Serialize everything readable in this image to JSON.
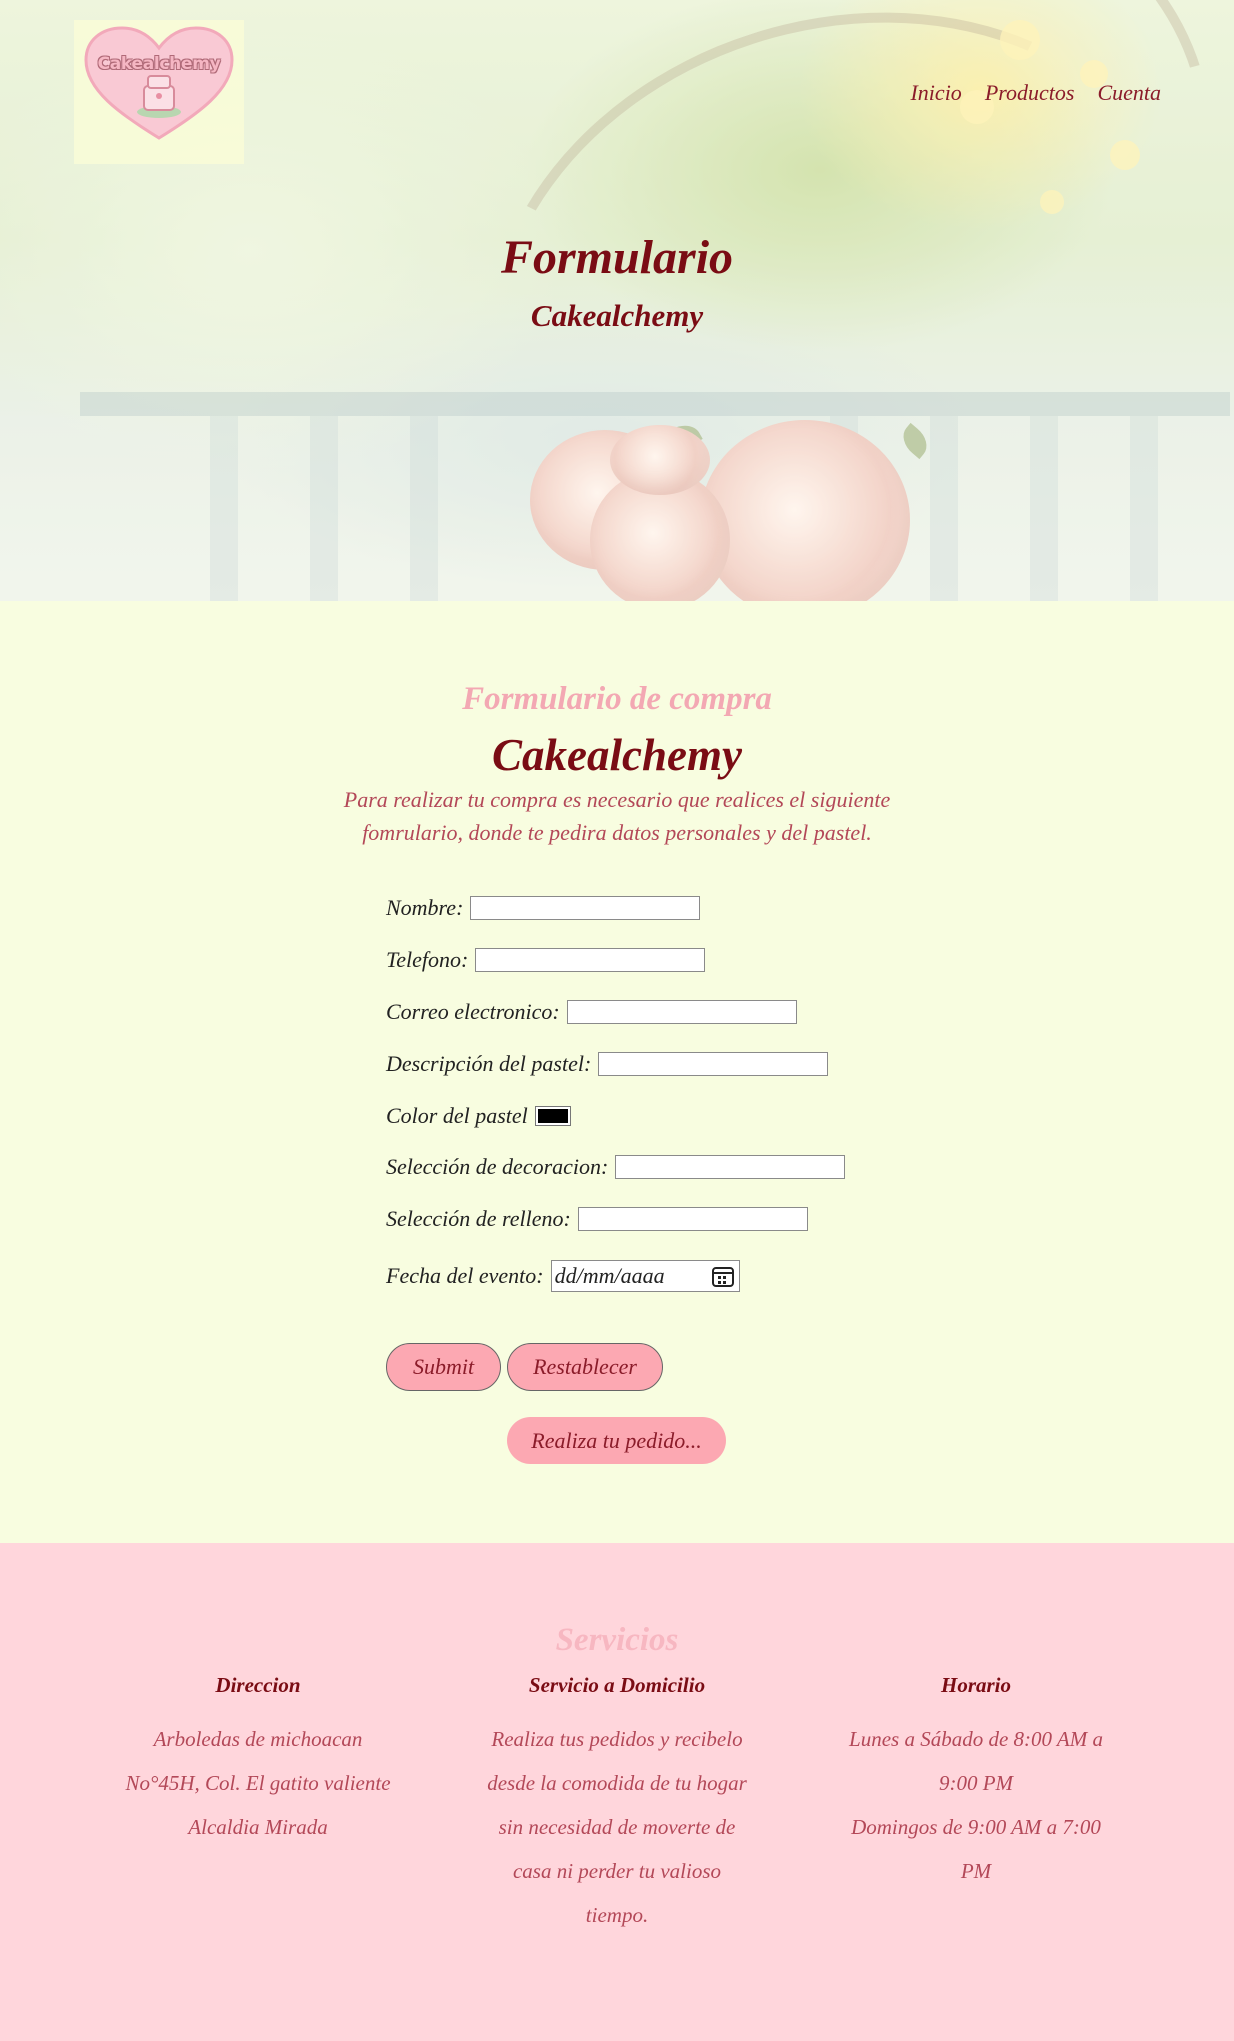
{
  "brand": {
    "logo_text": "Cakealchemy"
  },
  "nav": {
    "items": [
      "Inicio",
      "Productos",
      "Cuenta"
    ]
  },
  "hero": {
    "title": "Formulario",
    "subtitle": "Cakealchemy"
  },
  "form": {
    "eyebrow": "Formulario de compra",
    "title": "Cakealchemy",
    "description": "Para realizar tu compra es necesario que realices el siguiente fomrulario, donde te pedira datos personales y del pastel.",
    "fields": {
      "nombre": "Nombre:",
      "telefono": "Telefono:",
      "correo": "Correo electronico:",
      "descripcion": "Descripción del pastel:",
      "color": "Color del pastel",
      "decoracion": "Selección de decoracion:",
      "relleno": "Selección de relleno:",
      "fecha": "Fecha del evento:"
    },
    "date_placeholder": "dd/mm/aaaa",
    "color_value": "#000000",
    "submit_label": "Submit",
    "reset_label": "Restablecer",
    "order_label": "Realiza tu pedido..."
  },
  "services": {
    "title": "Servicios",
    "columns": [
      {
        "heading": "Direccion",
        "lines": [
          "Arboledas de michoacan",
          "No°45H, Col. El gatito valiente",
          "Alcaldia Mirada"
        ]
      },
      {
        "heading": "Servicio a Domicilio",
        "lines": [
          "Realiza tus pedidos y recibelo",
          "desde la comodida de tu hogar",
          "sin necesidad de moverte de",
          "casa ni perder tu valioso",
          "tiempo."
        ]
      },
      {
        "heading": "Horario",
        "lines": [
          "Lunes a Sábado de 8:00 AM a",
          "9:00 PM",
          "Domingos de 9:00 AM a 7:00",
          "PM"
        ]
      }
    ]
  },
  "colors": {
    "accent": "#7a0c14",
    "pink": "#fca8b2",
    "cream": "#f8fde0",
    "footer": "#ffd6dc"
  }
}
